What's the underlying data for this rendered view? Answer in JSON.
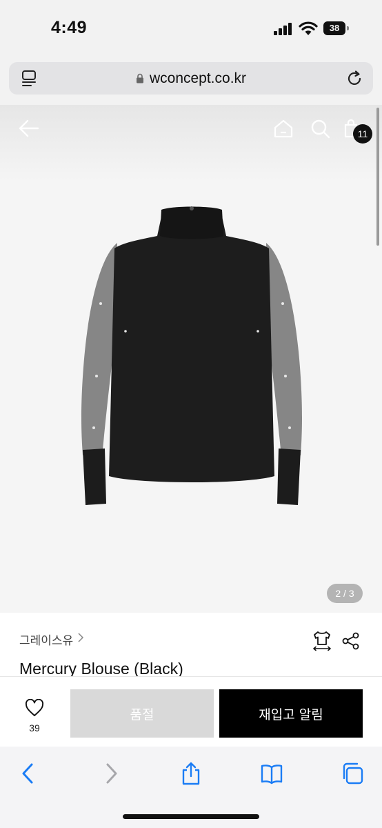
{
  "status_bar": {
    "time": "4:49",
    "battery": "38"
  },
  "browser": {
    "url": "wconcept.co.kr"
  },
  "header": {
    "cart_count": "11"
  },
  "gallery": {
    "pager": "2 / 3"
  },
  "product": {
    "brand": "그레이스유",
    "title": "Mercury Blouse (Black)"
  },
  "actions": {
    "like_count": "39",
    "soldout_label": "품절",
    "restock_label": "재입고 알림"
  },
  "colors": {
    "accent": "#000000",
    "disabled": "#d9d9d9",
    "link_blue": "#1a7cf5"
  }
}
